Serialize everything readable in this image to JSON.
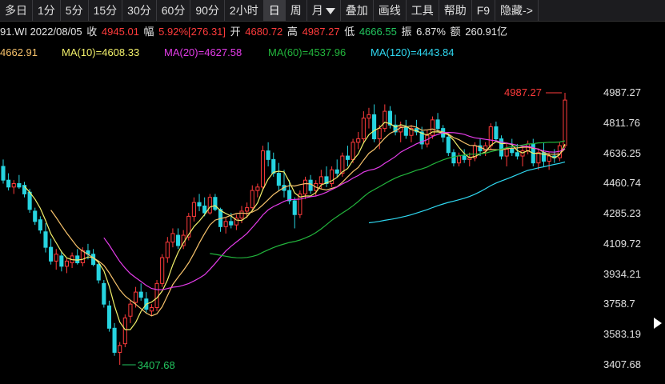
{
  "toolbar": {
    "items": [
      "多日",
      "1分",
      "5分",
      "15分",
      "30分",
      "60分",
      "90分",
      "2小时",
      "日",
      "周",
      "月",
      "叠加",
      "画线",
      "工具",
      "帮助",
      "F9",
      "隐藏->"
    ],
    "active_index": 8
  },
  "info": {
    "code_date": "91.WI 2022/08/05",
    "close_label": "收",
    "close_value": "4945.01",
    "amp_label": "幅",
    "amp_value": "5.92%[276.31]",
    "open_label": "开",
    "open_value": "4680.72",
    "high_label": "高",
    "high_value": "4987.27",
    "low_label": "低",
    "low_value": "4666.55",
    "swing_label": "振",
    "swing_value": "6.87%",
    "amount_label": "额",
    "amount_value": "260.91亿"
  },
  "ma_legend": {
    "ma5": "4662.91",
    "ma10": "MA(10)=4608.33",
    "ma20": "MA(20)=4627.58",
    "ma60": "MA(60)=4537.96",
    "ma120": "MA(120)=4443.84"
  },
  "colors": {
    "up": "#ff3b3b",
    "down": "#26d4e0",
    "ma5": "#f7c26b",
    "ma10": "#f2f06a",
    "ma20": "#e43ce9",
    "ma60": "#22b53c",
    "ma120": "#2fd9f2",
    "low_marker": "#22c55e"
  },
  "y_axis_labels": [
    "4987.27",
    "4811.76",
    "4636.25",
    "4460.74",
    "4285.23",
    "4109.72",
    "3934.21",
    "3758.7",
    "3583.19",
    "3407.68"
  ],
  "chart_data": {
    "type": "candlestick",
    "y_range": [
      3407.68,
      4987.27
    ],
    "high_label": "4987.27",
    "low_label": "3407.68",
    "candles": [
      {
        "o": 4560,
        "h": 4600,
        "l": 4460,
        "c": 4480
      },
      {
        "o": 4480,
        "h": 4520,
        "l": 4420,
        "c": 4440
      },
      {
        "o": 4440,
        "h": 4480,
        "l": 4400,
        "c": 4460
      },
      {
        "o": 4460,
        "h": 4510,
        "l": 4430,
        "c": 4440
      },
      {
        "o": 4450,
        "h": 4470,
        "l": 4380,
        "c": 4400
      },
      {
        "o": 4410,
        "h": 4430,
        "l": 4290,
        "c": 4310
      },
      {
        "o": 4300,
        "h": 4320,
        "l": 4220,
        "c": 4240
      },
      {
        "o": 4250,
        "h": 4270,
        "l": 4170,
        "c": 4190
      },
      {
        "o": 4180,
        "h": 4230,
        "l": 4060,
        "c": 4090
      },
      {
        "o": 4090,
        "h": 4140,
        "l": 3990,
        "c": 4010
      },
      {
        "o": 4010,
        "h": 4080,
        "l": 3960,
        "c": 4050
      },
      {
        "o": 4040,
        "h": 4070,
        "l": 3950,
        "c": 3980
      },
      {
        "o": 3980,
        "h": 4030,
        "l": 3940,
        "c": 4010
      },
      {
        "o": 4000,
        "h": 4060,
        "l": 3970,
        "c": 4040
      },
      {
        "o": 4040,
        "h": 4080,
        "l": 3990,
        "c": 4000
      },
      {
        "o": 4000,
        "h": 4090,
        "l": 3980,
        "c": 4070
      },
      {
        "o": 4070,
        "h": 4110,
        "l": 4020,
        "c": 4050
      },
      {
        "o": 4050,
        "h": 4080,
        "l": 3980,
        "c": 3990
      },
      {
        "o": 3990,
        "h": 4010,
        "l": 3880,
        "c": 3900
      },
      {
        "o": 3880,
        "h": 3900,
        "l": 3740,
        "c": 3760
      },
      {
        "o": 3750,
        "h": 3780,
        "l": 3600,
        "c": 3620
      },
      {
        "o": 3620,
        "h": 3650,
        "l": 3460,
        "c": 3480
      },
      {
        "o": 3480,
        "h": 3540,
        "l": 3407.68,
        "c": 3520
      },
      {
        "o": 3530,
        "h": 3700,
        "l": 3510,
        "c": 3680
      },
      {
        "o": 3690,
        "h": 3780,
        "l": 3650,
        "c": 3760
      },
      {
        "o": 3770,
        "h": 3860,
        "l": 3740,
        "c": 3830
      },
      {
        "o": 3830,
        "h": 3880,
        "l": 3780,
        "c": 3800
      },
      {
        "o": 3790,
        "h": 3830,
        "l": 3710,
        "c": 3730
      },
      {
        "o": 3720,
        "h": 3760,
        "l": 3690,
        "c": 3740
      },
      {
        "o": 3740,
        "h": 3900,
        "l": 3720,
        "c": 3880
      },
      {
        "o": 3880,
        "h": 4050,
        "l": 3860,
        "c": 4030
      },
      {
        "o": 4030,
        "h": 4150,
        "l": 4000,
        "c": 4120
      },
      {
        "o": 4120,
        "h": 4200,
        "l": 4090,
        "c": 4170
      },
      {
        "o": 4160,
        "h": 4200,
        "l": 4080,
        "c": 4100
      },
      {
        "o": 4100,
        "h": 4190,
        "l": 4080,
        "c": 4160
      },
      {
        "o": 4150,
        "h": 4290,
        "l": 4130,
        "c": 4270
      },
      {
        "o": 4270,
        "h": 4380,
        "l": 4240,
        "c": 4350
      },
      {
        "o": 4350,
        "h": 4400,
        "l": 4300,
        "c": 4330
      },
      {
        "o": 4330,
        "h": 4380,
        "l": 4270,
        "c": 4290
      },
      {
        "o": 4290,
        "h": 4400,
        "l": 4280,
        "c": 4380
      },
      {
        "o": 4380,
        "h": 4400,
        "l": 4300,
        "c": 4310
      },
      {
        "o": 4310,
        "h": 4320,
        "l": 4180,
        "c": 4210
      },
      {
        "o": 4210,
        "h": 4260,
        "l": 4170,
        "c": 4240
      },
      {
        "o": 4240,
        "h": 4290,
        "l": 4200,
        "c": 4220
      },
      {
        "o": 4220,
        "h": 4280,
        "l": 4190,
        "c": 4260
      },
      {
        "o": 4260,
        "h": 4330,
        "l": 4230,
        "c": 4300
      },
      {
        "o": 4300,
        "h": 4350,
        "l": 4260,
        "c": 4320
      },
      {
        "o": 4320,
        "h": 4450,
        "l": 4300,
        "c": 4420
      },
      {
        "o": 4420,
        "h": 4460,
        "l": 4380,
        "c": 4440
      },
      {
        "o": 4440,
        "h": 4680,
        "l": 4420,
        "c": 4650
      },
      {
        "o": 4650,
        "h": 4700,
        "l": 4560,
        "c": 4600
      },
      {
        "o": 4600,
        "h": 4640,
        "l": 4500,
        "c": 4520
      },
      {
        "o": 4520,
        "h": 4580,
        "l": 4420,
        "c": 4450
      },
      {
        "o": 4450,
        "h": 4540,
        "l": 4380,
        "c": 4420
      },
      {
        "o": 4420,
        "h": 4480,
        "l": 4340,
        "c": 4360
      },
      {
        "o": 4360,
        "h": 4380,
        "l": 4200,
        "c": 4280
      },
      {
        "o": 4280,
        "h": 4420,
        "l": 4260,
        "c": 4400
      },
      {
        "o": 4400,
        "h": 4500,
        "l": 4370,
        "c": 4480
      },
      {
        "o": 4480,
        "h": 4510,
        "l": 4400,
        "c": 4420
      },
      {
        "o": 4420,
        "h": 4480,
        "l": 4390,
        "c": 4460
      },
      {
        "o": 4460,
        "h": 4540,
        "l": 4430,
        "c": 4500
      },
      {
        "o": 4500,
        "h": 4560,
        "l": 4440,
        "c": 4460
      },
      {
        "o": 4460,
        "h": 4560,
        "l": 4440,
        "c": 4540
      },
      {
        "o": 4540,
        "h": 4600,
        "l": 4500,
        "c": 4520
      },
      {
        "o": 4520,
        "h": 4640,
        "l": 4500,
        "c": 4620
      },
      {
        "o": 4620,
        "h": 4680,
        "l": 4560,
        "c": 4600
      },
      {
        "o": 4600,
        "h": 4720,
        "l": 4580,
        "c": 4700
      },
      {
        "o": 4700,
        "h": 4760,
        "l": 4660,
        "c": 4720
      },
      {
        "o": 4720,
        "h": 4880,
        "l": 4700,
        "c": 4840
      },
      {
        "o": 4840,
        "h": 4900,
        "l": 4780,
        "c": 4860
      },
      {
        "o": 4860,
        "h": 4920,
        "l": 4700,
        "c": 4720
      },
      {
        "o": 4720,
        "h": 4800,
        "l": 4660,
        "c": 4780
      },
      {
        "o": 4780,
        "h": 4920,
        "l": 4760,
        "c": 4880
      },
      {
        "o": 4880,
        "h": 4910,
        "l": 4780,
        "c": 4800
      },
      {
        "o": 4800,
        "h": 4860,
        "l": 4740,
        "c": 4760
      },
      {
        "o": 4760,
        "h": 4820,
        "l": 4700,
        "c": 4790
      },
      {
        "o": 4790,
        "h": 4830,
        "l": 4720,
        "c": 4740
      },
      {
        "o": 4740,
        "h": 4800,
        "l": 4700,
        "c": 4780
      },
      {
        "o": 4780,
        "h": 4830,
        "l": 4740,
        "c": 4760
      },
      {
        "o": 4760,
        "h": 4790,
        "l": 4660,
        "c": 4690
      },
      {
        "o": 4690,
        "h": 4770,
        "l": 4670,
        "c": 4740
      },
      {
        "o": 4740,
        "h": 4850,
        "l": 4720,
        "c": 4830
      },
      {
        "o": 4830,
        "h": 4870,
        "l": 4760,
        "c": 4780
      },
      {
        "o": 4780,
        "h": 4800,
        "l": 4700,
        "c": 4730
      },
      {
        "o": 4730,
        "h": 4750,
        "l": 4620,
        "c": 4640
      },
      {
        "o": 4640,
        "h": 4660,
        "l": 4560,
        "c": 4580
      },
      {
        "o": 4580,
        "h": 4640,
        "l": 4560,
        "c": 4620
      },
      {
        "o": 4620,
        "h": 4660,
        "l": 4580,
        "c": 4600
      },
      {
        "o": 4600,
        "h": 4640,
        "l": 4560,
        "c": 4610
      },
      {
        "o": 4610,
        "h": 4700,
        "l": 4590,
        "c": 4680
      },
      {
        "o": 4680,
        "h": 4720,
        "l": 4620,
        "c": 4650
      },
      {
        "o": 4650,
        "h": 4700,
        "l": 4620,
        "c": 4680
      },
      {
        "o": 4680,
        "h": 4810,
        "l": 4660,
        "c": 4790
      },
      {
        "o": 4790,
        "h": 4820,
        "l": 4700,
        "c": 4720
      },
      {
        "o": 4720,
        "h": 4740,
        "l": 4600,
        "c": 4620
      },
      {
        "o": 4620,
        "h": 4700,
        "l": 4560,
        "c": 4660
      },
      {
        "o": 4660,
        "h": 4720,
        "l": 4620,
        "c": 4640
      },
      {
        "o": 4640,
        "h": 4690,
        "l": 4600,
        "c": 4620
      },
      {
        "o": 4620,
        "h": 4680,
        "l": 4560,
        "c": 4650
      },
      {
        "o": 4650,
        "h": 4710,
        "l": 4630,
        "c": 4690
      },
      {
        "o": 4690,
        "h": 4720,
        "l": 4560,
        "c": 4580
      },
      {
        "o": 4580,
        "h": 4660,
        "l": 4540,
        "c": 4640
      },
      {
        "o": 4640,
        "h": 4700,
        "l": 4560,
        "c": 4590
      },
      {
        "o": 4590,
        "h": 4640,
        "l": 4540,
        "c": 4620
      },
      {
        "o": 4620,
        "h": 4660,
        "l": 4580,
        "c": 4610
      },
      {
        "o": 4610,
        "h": 4700,
        "l": 4590,
        "c": 4680
      },
      {
        "o": 4680.72,
        "h": 4987.27,
        "l": 4666.55,
        "c": 4945.01
      }
    ]
  }
}
